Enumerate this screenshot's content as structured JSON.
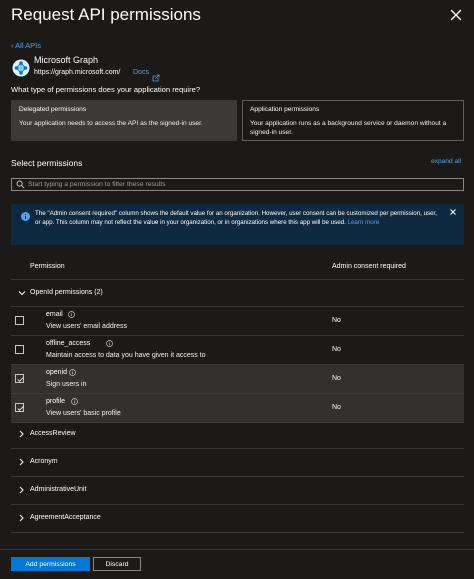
{
  "header": {
    "title": "Request API permissions"
  },
  "nav": {
    "back_label": "‹ All APIs"
  },
  "api": {
    "name": "Microsoft Graph",
    "url": "https://graph.microsoft.com/",
    "docs_label": "Docs"
  },
  "question": "What type of permissions does your application require?",
  "permission_types": [
    {
      "title": "Delegated permissions",
      "description": "Your application needs to access the API as the signed-in user.",
      "selected": true
    },
    {
      "title": "Application permissions",
      "description": "Your application runs as a background service or daemon without a signed-in user.",
      "selected": false
    }
  ],
  "select_permissions": {
    "title": "Select permissions",
    "expand_all_label": "expand all",
    "search_placeholder": "Start typing a permission to filter these results"
  },
  "info_banner": {
    "text": "The \"Admin consent required\" column shows the default value for an organization. However, user consent can be customized per permission, user, or app. This column may not reflect the value in your organization, or in organizations where this app will be used.",
    "link": "Learn more"
  },
  "table": {
    "headers": {
      "permission": "Permission",
      "admin": "Admin consent required"
    },
    "group_label": "OpenId permissions (2)",
    "rows": [
      {
        "name": "email",
        "description": "View users' email address",
        "admin": "No",
        "checked": false
      },
      {
        "name": "offline_access",
        "description": "Maintain access to data you have given it access to",
        "admin": "No",
        "checked": false
      },
      {
        "name": "openid",
        "description": "Sign users in",
        "admin": "No",
        "checked": true
      },
      {
        "name": "profile",
        "description": "View users' basic profile",
        "admin": "No",
        "checked": true
      }
    ],
    "collapsed_groups": [
      "AccessReview",
      "Acronym",
      "AdministrativeUnit",
      "AgreementAcceptance"
    ]
  },
  "footer": {
    "add_label": "Add permissions",
    "discard_label": "Discard"
  },
  "colors": {
    "accent": "#0078d4",
    "link": "#5ba0e5",
    "background": "#1b1a19",
    "info_bg": "#0f2940"
  }
}
